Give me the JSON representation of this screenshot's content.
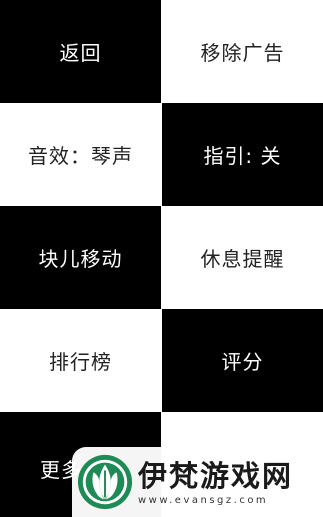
{
  "menu": {
    "back": "返回",
    "remove_ads": "移除广告",
    "sound_effect": "音效：琴声",
    "guide": "指引: 关",
    "block_move": "块儿移动",
    "rest_reminder": "休息提醒",
    "leaderboard": "排行榜",
    "rate": "评分",
    "more": "更多"
  },
  "watermark": {
    "title": "伊梵游戏网",
    "url": "www.evansgz.com",
    "brand_color": "#1e8a55"
  }
}
